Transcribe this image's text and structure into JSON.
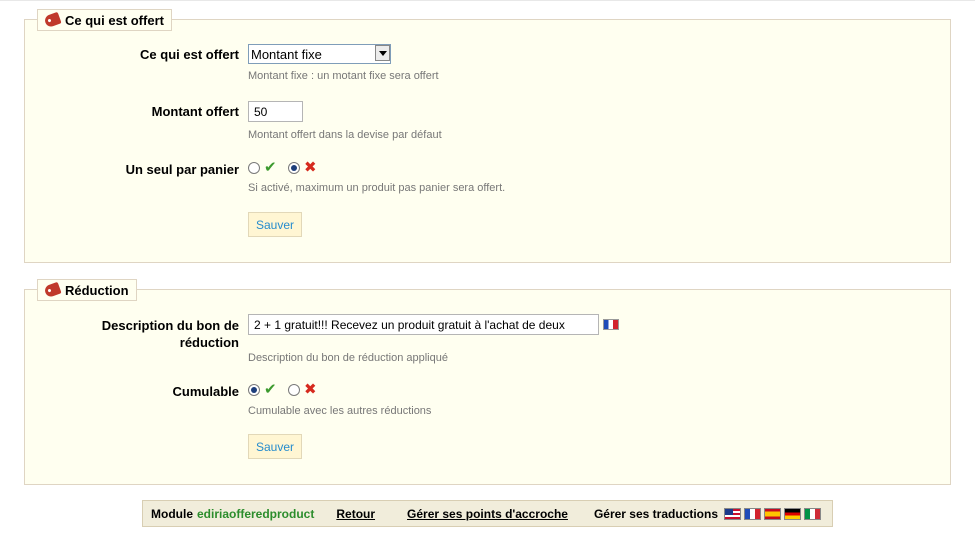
{
  "offer": {
    "legend": "Ce qui est offert",
    "what_label": "Ce qui est offert",
    "what_options": [
      "Montant fixe"
    ],
    "what_selected": "Montant fixe",
    "what_hint": "Montant fixe : un motant fixe sera offert",
    "amount_label": "Montant offert",
    "amount_value": "50",
    "amount_hint": "Montant offert dans la devise par défaut",
    "single_label": "Un seul par panier",
    "single_selected": "no",
    "single_hint": "Si activé, maximum un produit pas panier sera offert.",
    "save_label": "Sauver"
  },
  "reduction": {
    "legend": "Réduction",
    "desc_label_line1": "Description du bon de",
    "desc_label_line2": "réduction",
    "desc_value": "2 + 1 gratuit!!! Recevez un produit gratuit à l'achat de deux",
    "desc_hint": "Description du bon de réduction appliqué",
    "cumul_label": "Cumulable",
    "cumul_selected": "yes",
    "cumul_hint": "Cumulable avec les autres réductions",
    "save_label": "Sauver"
  },
  "footer": {
    "module_prefix": "Module",
    "module_name": "ediriaofferedproduct",
    "back_link": "Retour",
    "hooks_link": "Gérer ses points d'accroche",
    "translations_label": "Gérer ses traductions",
    "flags": [
      "flag-us-icon",
      "flag-fr-icon",
      "flag-es-icon",
      "flag-de-icon",
      "flag-it-icon"
    ]
  },
  "colors": {
    "panel_bg": "#fffff0",
    "panel_border": "#dfd5c3",
    "button_text": "#268ccd",
    "module_name": "#2c8d2c",
    "check": "#3c9a2e",
    "cross": "#d62a1e"
  }
}
